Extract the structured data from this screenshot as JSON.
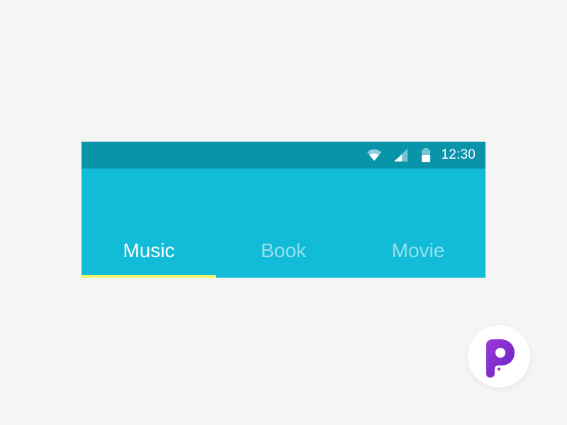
{
  "status_bar": {
    "time": "12:30",
    "icons": [
      "wifi-icon",
      "cellular-signal-icon",
      "battery-icon"
    ]
  },
  "tabs": [
    {
      "label": "Music",
      "active": true
    },
    {
      "label": "Book",
      "active": false
    },
    {
      "label": "Movie",
      "active": false
    }
  ],
  "colors": {
    "background": "#f5f5f5",
    "app_bar": "#12bbd7",
    "status_bar": "#0a94aa",
    "tab_indicator": "#f2f36a",
    "active_tab_text": "#ffffff",
    "inactive_tab_text": "#a8e5ef",
    "logo": "#7b2fc9"
  },
  "logo": {
    "icon": "p-logo-icon"
  }
}
